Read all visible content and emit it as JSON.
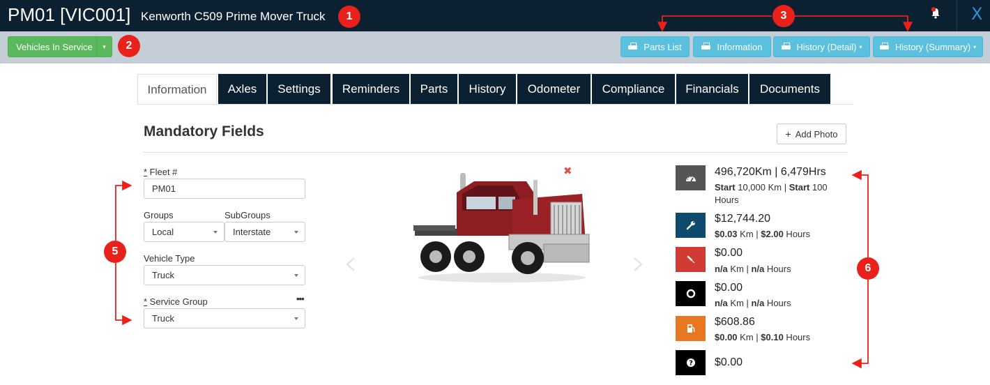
{
  "header": {
    "vehicle_code": "PM01 [VIC001]",
    "vehicle_name": "Kenworth C509 Prime Mover Truck",
    "close_label": "X"
  },
  "toolbar": {
    "status_button": "Vehicles In Service",
    "parts_list": "Parts List",
    "information": "Information",
    "history_detail": "History (Detail)",
    "history_summary": "History (Summary)"
  },
  "tabs": [
    "Information",
    "Axles",
    "Settings",
    "Reminders",
    "Parts",
    "History",
    "Odometer",
    "Compliance",
    "Financials",
    "Documents"
  ],
  "form": {
    "section_title": "Mandatory Fields",
    "add_photo": "Add Photo",
    "fleet_label_req": "*",
    "fleet_label": " Fleet #",
    "fleet_value": "PM01",
    "groups_label": "Groups",
    "groups_value": "Local",
    "subgroups_label": "SubGroups",
    "subgroups_value": "Interstate",
    "vehicle_type_label": "Vehicle Type",
    "vehicle_type_value": "Truck",
    "service_group_req": "*",
    "service_group_label": " Service Group",
    "service_group_value": "Truck",
    "more": "•••"
  },
  "stats": [
    {
      "icon": "speedometer-icon",
      "color": "#555555",
      "main": "496,720Km | 6,479Hrs",
      "sub_html": [
        "Start",
        " 10,000 Km | ",
        "Start",
        " 100"
      ],
      "sub2": "Hours"
    },
    {
      "icon": "wrench-icon",
      "color": "#0e4a6b",
      "main": "$12,744.20",
      "a": "$0.03",
      "b": " Km | ",
      "c": "$2.00",
      "d": " Hours"
    },
    {
      "icon": "screwdriver-icon",
      "color": "#d23a34",
      "main": "$0.00",
      "a": "n/a",
      "b": " Km | ",
      "c": "n/a",
      "d": " Hours"
    },
    {
      "icon": "tyre-icon",
      "color": "#000000",
      "main": "$0.00",
      "a": "n/a",
      "b": " Km | ",
      "c": "n/a",
      "d": " Hours"
    },
    {
      "icon": "fuel-pump-icon",
      "color": "#e87722",
      "main": "$608.86",
      "a": "$0.00",
      "b": " Km | ",
      "c": "$0.10",
      "d": " Hours"
    },
    {
      "icon": "question-icon",
      "color": "#000000",
      "main": "$0.00"
    }
  ],
  "annotations": [
    "1",
    "2",
    "3",
    "5",
    "6"
  ],
  "colors": {
    "accent_red": "#e8221b",
    "topbar": "#0b2031",
    "toolbar": "#c5ced6"
  }
}
